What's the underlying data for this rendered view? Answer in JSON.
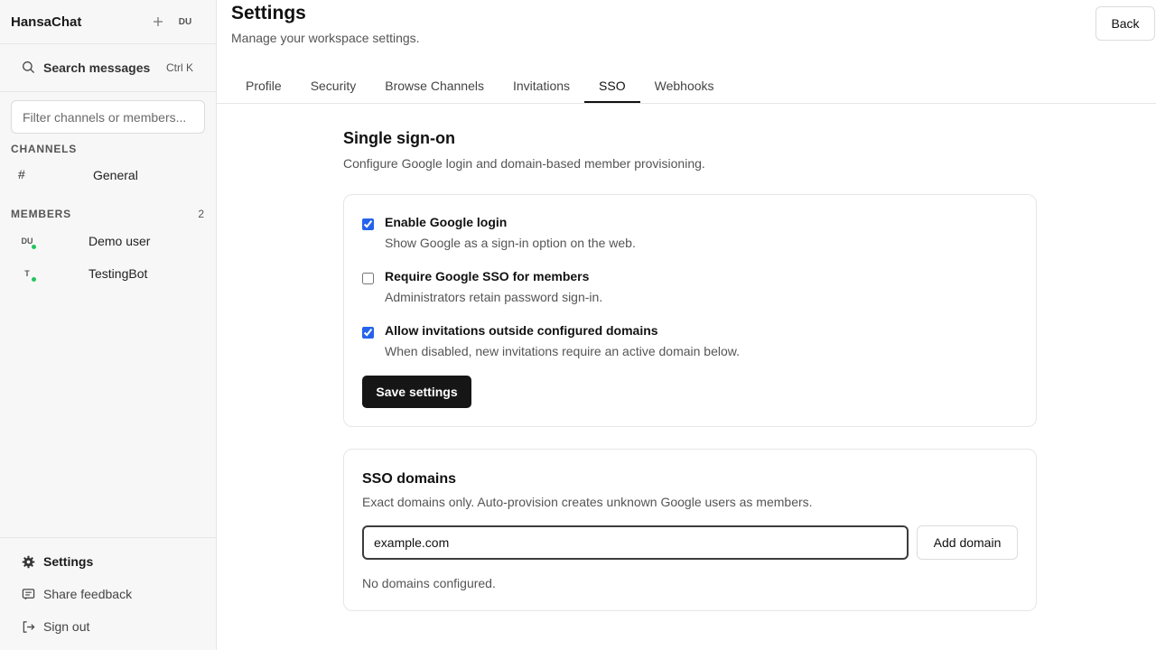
{
  "sidebar": {
    "app_name": "HansaChat",
    "user_initials": "DU",
    "search": {
      "label": "Search messages",
      "shortcut": "Ctrl K"
    },
    "filter": {
      "placeholder": "Filter channels or members..."
    },
    "channels": {
      "label": "CHANNELS",
      "items": [
        {
          "icon": "#",
          "name": "General"
        }
      ]
    },
    "members": {
      "label": "MEMBERS",
      "count": "2",
      "items": [
        {
          "initials": "DU",
          "name": "Demo user",
          "status": "online"
        },
        {
          "initials": "T",
          "name": "TestingBot",
          "status": "online"
        }
      ]
    },
    "footer": {
      "settings": "Settings",
      "feedback": "Share feedback",
      "signout": "Sign out"
    }
  },
  "header": {
    "title": "Settings",
    "subtitle": "Manage your workspace settings.",
    "back": "Back"
  },
  "tabs": [
    {
      "label": "Profile"
    },
    {
      "label": "Security"
    },
    {
      "label": "Browse Channels"
    },
    {
      "label": "Invitations"
    },
    {
      "label": "SSO",
      "active": true
    },
    {
      "label": "Webhooks"
    }
  ],
  "sso": {
    "title": "Single sign-on",
    "description": "Configure Google login and domain-based member provisioning.",
    "options": [
      {
        "title": "Enable Google login",
        "description": "Show Google as a sign-in option on the web.",
        "checked": true
      },
      {
        "title": "Require Google SSO for members",
        "description": "Administrators retain password sign-in.",
        "checked": false
      },
      {
        "title": "Allow invitations outside configured domains",
        "description": "When disabled, new invitations require an active domain below.",
        "checked": true
      }
    ],
    "save_label": "Save settings"
  },
  "domains": {
    "title": "SSO domains",
    "description": "Exact domains only. Auto-provision creates unknown Google users as members.",
    "input_value": "example.com",
    "add_label": "Add domain",
    "empty": "No domains configured."
  },
  "colors": {
    "accent": "#2563eb",
    "primary_button": "#161616",
    "online": "#22c55e"
  }
}
